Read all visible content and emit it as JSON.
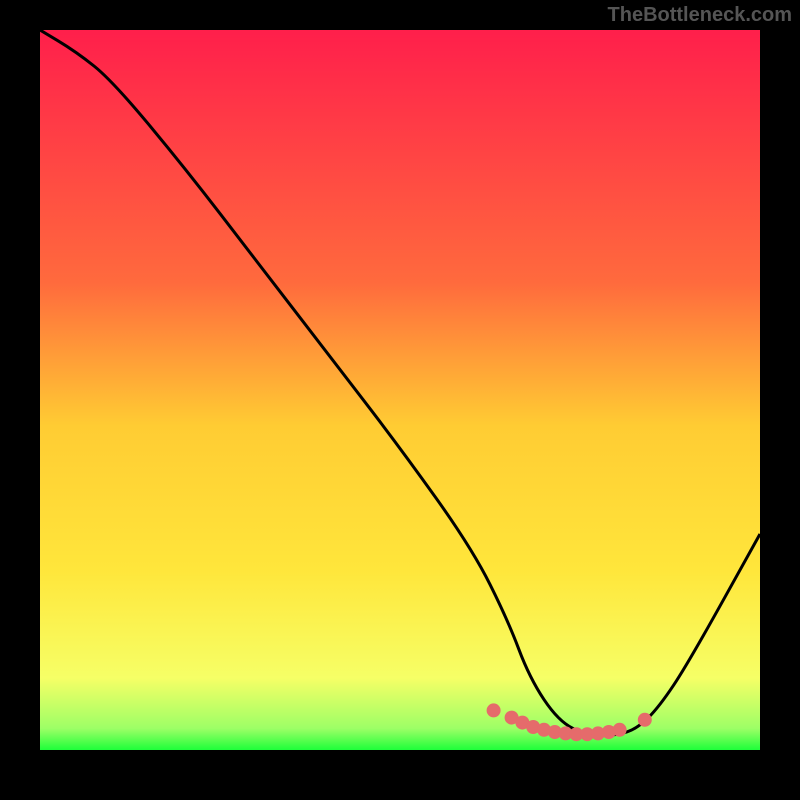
{
  "watermark": "TheBottleneck.com",
  "chart_data": {
    "type": "line",
    "title": "",
    "xlabel": "",
    "ylabel": "",
    "xlim": [
      0,
      100
    ],
    "ylim": [
      0,
      100
    ],
    "grid": false,
    "legend": false,
    "gradient_stops": [
      {
        "offset": 0,
        "color": "#ff1f4b"
      },
      {
        "offset": 0.35,
        "color": "#ff6a3d"
      },
      {
        "offset": 0.55,
        "color": "#ffcc33"
      },
      {
        "offset": 0.75,
        "color": "#ffe63b"
      },
      {
        "offset": 0.9,
        "color": "#f6ff66"
      },
      {
        "offset": 0.97,
        "color": "#9dff66"
      },
      {
        "offset": 1.0,
        "color": "#1eff3a"
      }
    ],
    "series": [
      {
        "name": "bottleneck-curve",
        "color": "#000000",
        "x": [
          0,
          5,
          10,
          20,
          30,
          40,
          50,
          60,
          65,
          68,
          72,
          76,
          80,
          83,
          86,
          90,
          100
        ],
        "y": [
          100,
          97,
          93,
          81,
          68,
          55,
          42,
          28,
          18,
          10,
          4,
          2,
          2,
          3,
          6,
          12,
          30
        ]
      }
    ],
    "markers": {
      "name": "highlight-dots",
      "color": "#e56b6b",
      "radius": 7,
      "x": [
        63,
        65.5,
        67,
        68.5,
        70,
        71.5,
        73,
        74.5,
        76,
        77.5,
        79,
        80.5,
        84
      ],
      "y": [
        5.5,
        4.5,
        3.8,
        3.2,
        2.8,
        2.5,
        2.3,
        2.2,
        2.2,
        2.3,
        2.5,
        2.8,
        4.2
      ]
    }
  }
}
